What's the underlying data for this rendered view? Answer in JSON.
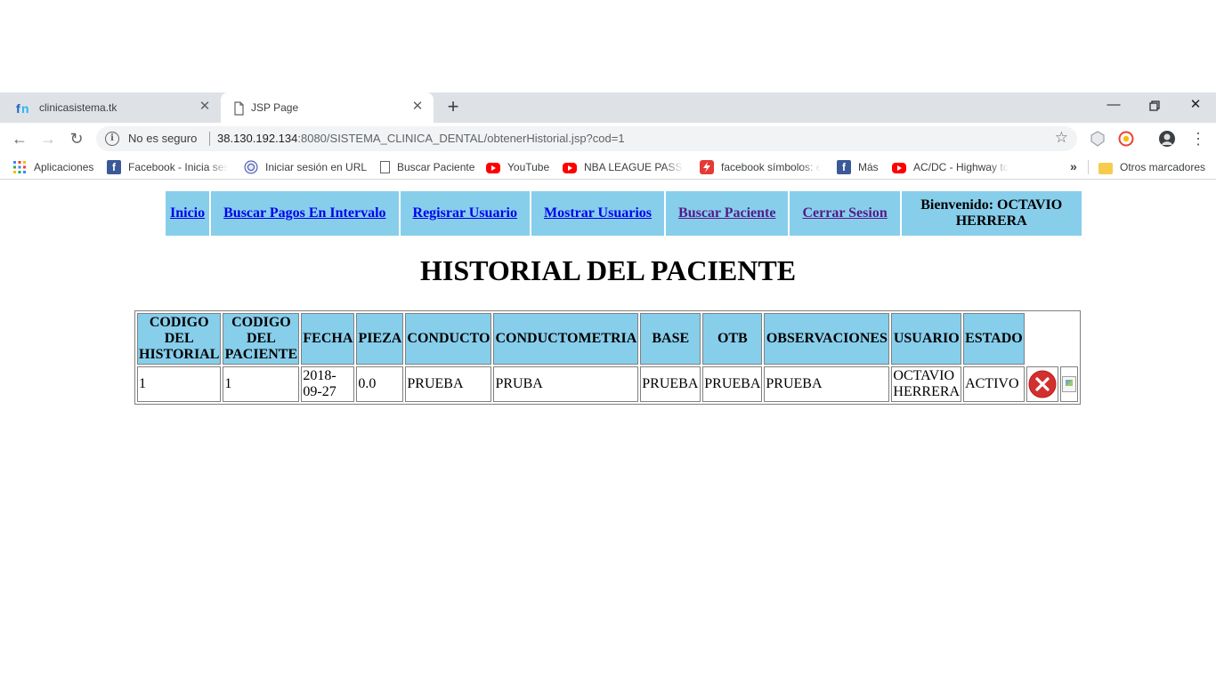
{
  "browser": {
    "tabs": [
      {
        "title": "clinicasistema.tk",
        "active": false
      },
      {
        "title": "JSP Page",
        "active": true
      }
    ],
    "address": {
      "security_label": "No es seguro",
      "url_host": "38.130.192.134",
      "url_rest": ":8080/SISTEMA_CLINICA_DENTAL/obtenerHistorial.jsp?cod=1"
    },
    "bookmarks": [
      {
        "label": "Aplicaciones",
        "icon": "apps-grid-icon"
      },
      {
        "label": "Facebook - Inicia sesi",
        "icon": "facebook-icon"
      },
      {
        "label": "Iniciar sesión en URL",
        "icon": "globe-seal-icon"
      },
      {
        "label": "Buscar Paciente",
        "icon": "document-icon"
      },
      {
        "label": "YouTube",
        "icon": "youtube-icon"
      },
      {
        "label": "NBA LEAGUE PASS H",
        "icon": "youtube-icon"
      },
      {
        "label": "facebook símbolos: e",
        "icon": "lightning-icon"
      },
      {
        "label": "Más",
        "icon": "facebook-icon"
      },
      {
        "label": "AC/DC - Highway to",
        "icon": "youtube-icon"
      },
      {
        "label": "Otros marcadores",
        "icon": "folder-icon"
      }
    ]
  },
  "nav": {
    "inicio": "Inicio",
    "buscar_pagos": "Buscar Pagos En Intervalo",
    "registrar_usuario": "Regisrar Usuario",
    "mostrar_usuarios": "Mostrar Usuarios",
    "buscar_paciente": "Buscar Paciente",
    "cerrar_sesion": "Cerrar Sesion",
    "welcome_line1": "Bienvenido: OCTAVIO",
    "welcome_line2": "HERRERA"
  },
  "heading": "HISTORIAL DEL PACIENTE",
  "table": {
    "headers": [
      [
        "CODIGO",
        "DEL",
        "HISTORIAL"
      ],
      [
        "CODIGO",
        "DEL",
        "PACIENTE"
      ],
      [
        "FECHA"
      ],
      [
        "PIEZA"
      ],
      [
        "CONDUCTO"
      ],
      [
        "CONDUCTOMETRIA"
      ],
      [
        "BASE"
      ],
      [
        "OTB"
      ],
      [
        "OBSERVACIONES"
      ],
      [
        "USUARIO"
      ],
      [
        "ESTADO"
      ]
    ],
    "rows": [
      {
        "codigo_historial": "1",
        "codigo_paciente": "1",
        "fecha_1": "2018-",
        "fecha_2": "09-27",
        "pieza": "0.0",
        "conducto": "PRUEBA",
        "conductometria": "PRUBA",
        "base": "PRUEBA",
        "otb": "PRUEBA",
        "observaciones": "PRUEBA",
        "usuario_1": "OCTAVIO",
        "usuario_2": "HERRERA",
        "estado": "ACTIVO"
      }
    ]
  },
  "colors": {
    "menu_bg": "#87ceeb",
    "header_bg": "#87ceeb",
    "link": "#0000ee",
    "visited_link": "#551a8b",
    "delete_icon": "#d32f2f"
  }
}
